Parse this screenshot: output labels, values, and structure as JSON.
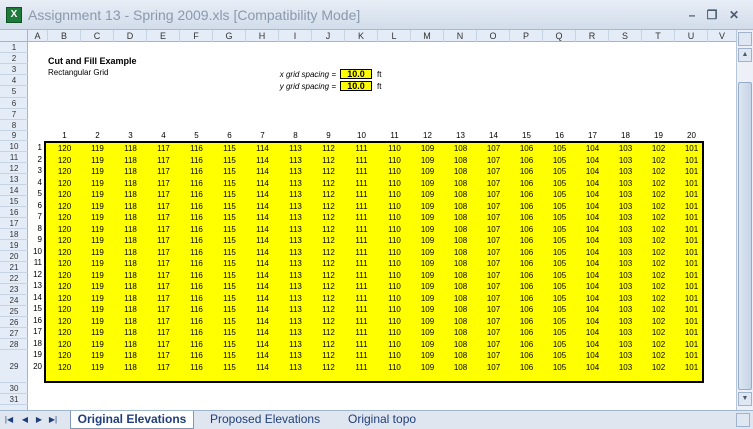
{
  "window": {
    "title": "Assignment 13 - Spring 2009.xls  [Compatibility Mode]",
    "app_icon": "excel-icon",
    "controls": {
      "minimize": "–",
      "restore": "❐",
      "close": "✕"
    }
  },
  "columns": [
    "A",
    "B",
    "C",
    "D",
    "E",
    "F",
    "G",
    "H",
    "I",
    "J",
    "K",
    "L",
    "M",
    "N",
    "O",
    "P",
    "Q",
    "R",
    "S",
    "T",
    "U",
    "V"
  ],
  "rows": [
    "1",
    "2",
    "3",
    "4",
    "5",
    "6",
    "7",
    "8",
    "9",
    "10",
    "11",
    "12",
    "13",
    "14",
    "15",
    "16",
    "17",
    "18",
    "19",
    "20",
    "21",
    "22",
    "23",
    "24",
    "25",
    "26",
    "27",
    "28",
    "29",
    "30",
    "31"
  ],
  "sheet": {
    "title": "Cut and Fill Example",
    "subtitle": "Rectangular Grid",
    "x_spacing_label": "x grid spacing =",
    "x_spacing_value": "10.0",
    "y_spacing_label": "y grid spacing =",
    "y_spacing_value": "10.0",
    "unit": "ft",
    "grid_col_numbers": [
      "1",
      "2",
      "3",
      "4",
      "5",
      "6",
      "7",
      "8",
      "9",
      "10",
      "11",
      "12",
      "13",
      "14",
      "15",
      "16",
      "17",
      "18",
      "19",
      "20"
    ],
    "grid_row_numbers": [
      "1",
      "2",
      "3",
      "4",
      "5",
      "6",
      "7",
      "8",
      "9",
      "10",
      "11",
      "12",
      "13",
      "14",
      "15",
      "16",
      "17",
      "18",
      "19",
      "20"
    ],
    "grid_row_values": [
      "120",
      "119",
      "118",
      "117",
      "116",
      "115",
      "114",
      "113",
      "112",
      "111",
      "110",
      "109",
      "108",
      "107",
      "106",
      "105",
      "104",
      "103",
      "102",
      "101"
    ],
    "grid_fill_color": "#ffff00"
  },
  "tabs": [
    {
      "label": "Original Elevations",
      "active": true
    },
    {
      "label": "Proposed Elevations",
      "active": false
    },
    {
      "label": "Original topo",
      "active": false
    }
  ],
  "nav_buttons": [
    "|◀",
    "◀",
    "▶",
    "▶|"
  ]
}
